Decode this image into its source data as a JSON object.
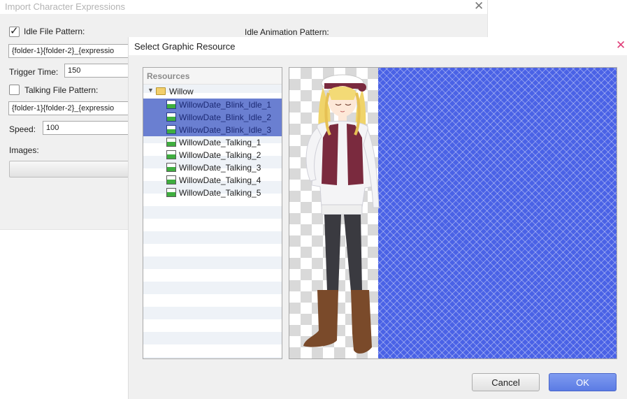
{
  "bg_dialog": {
    "title": "Import Character Expressions",
    "idle_label": "Idle File Pattern:",
    "idle_checked": true,
    "idle_pattern_value": "{folder-1}{folder-2}_{expressio",
    "idle_animation_label": "Idle Animation Pattern:",
    "trigger_time_label": "Trigger Time:",
    "trigger_time_value": "150",
    "talking_label": "Talking File Pattern:",
    "talking_checked": false,
    "talking_pattern_value": "{folder-1}{folder-2}_{expressio",
    "speed_label": "Speed:",
    "speed_value": "100",
    "images_label": "Images:"
  },
  "fg_dialog": {
    "title": "Select Graphic Resource",
    "resources_header": "Resources",
    "folder": "Willow",
    "items": [
      {
        "label": "WillowDate_Blink_Idle_1",
        "selected": true
      },
      {
        "label": "WillowDate_Blink_Idle_2",
        "selected": true
      },
      {
        "label": "WillowDate_Blink_Idle_3",
        "selected": true
      },
      {
        "label": "WillowDate_Talking_1",
        "selected": false
      },
      {
        "label": "WillowDate_Talking_2",
        "selected": false
      },
      {
        "label": "WillowDate_Talking_3",
        "selected": false
      },
      {
        "label": "WillowDate_Talking_4",
        "selected": false
      },
      {
        "label": "WillowDate_Talking_5",
        "selected": false
      }
    ],
    "cancel_label": "Cancel",
    "ok_label": "OK"
  },
  "icons": {
    "close": "close-icon",
    "folder": "folder-icon",
    "image": "image-icon",
    "expand": "expand-triangle-icon"
  },
  "colors": {
    "selection": "#6a7fd1",
    "ok_button": "#5b7be4",
    "preview_background": "#4a62e6"
  }
}
